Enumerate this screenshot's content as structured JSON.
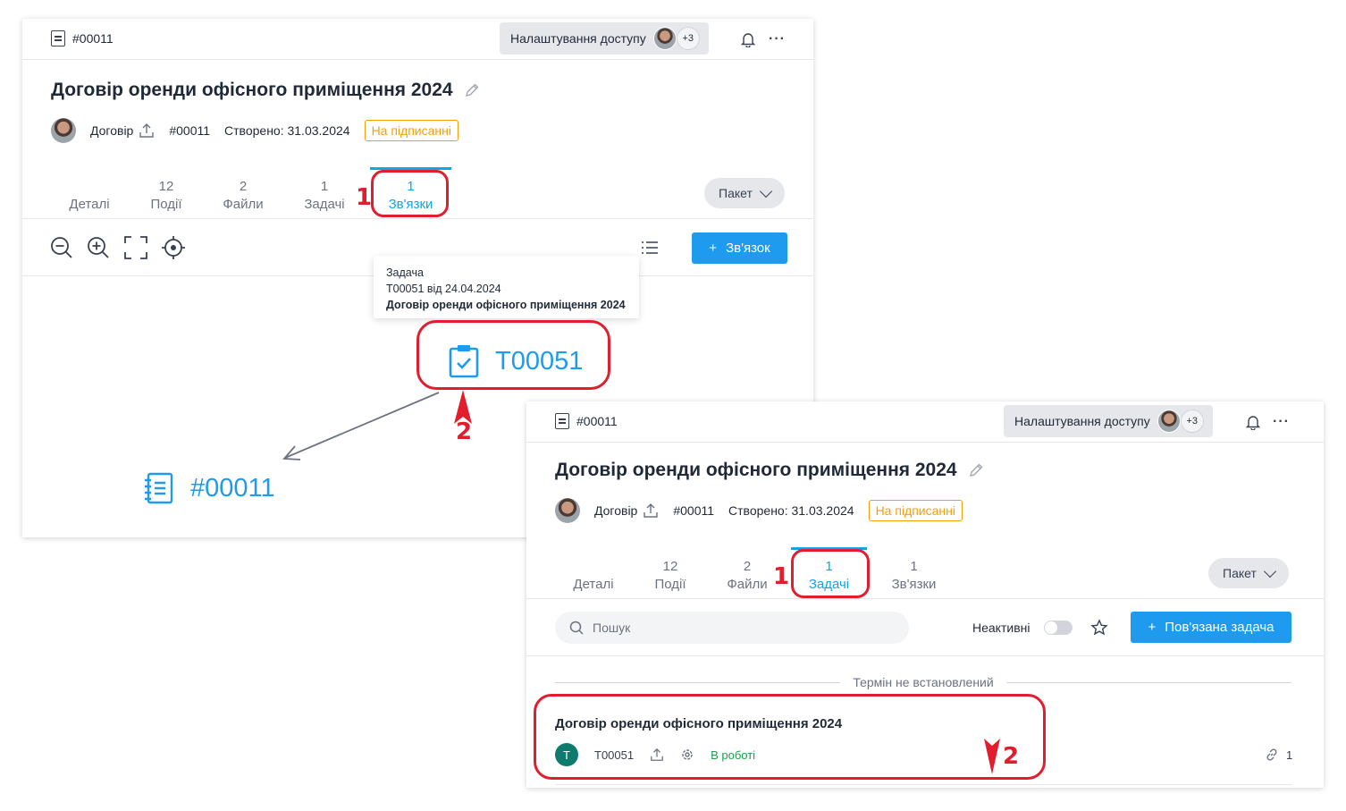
{
  "doc_id": "#00011",
  "access_settings_label": "Налаштування доступу",
  "access_extra": "+3",
  "document_title": "Договір оренди офісного приміщення 2024",
  "meta": {
    "type": "Договір",
    "number": "#00011",
    "created": "Створено: 31.03.2024",
    "status": "На підписанні"
  },
  "panel_a": {
    "tabs": [
      {
        "count": "",
        "label": "Деталі"
      },
      {
        "count": "12",
        "label": "Події"
      },
      {
        "count": "2",
        "label": "Файли"
      },
      {
        "count": "1",
        "label": "Задачі"
      },
      {
        "count": "1",
        "label": "Зв'язки"
      }
    ],
    "active_tab": "Зв'язки",
    "package_label": "Пакет",
    "add_link_label": "Зв'язок",
    "tooltip": {
      "line1": "Задача",
      "line2": "T00051 від 24.04.2024",
      "line3": "Договір оренди офісного приміщення 2024"
    },
    "task_node_label": "T00051",
    "doc_node_label": "#00011"
  },
  "panel_b": {
    "tabs": [
      {
        "count": "",
        "label": "Деталі"
      },
      {
        "count": "12",
        "label": "Події"
      },
      {
        "count": "2",
        "label": "Файли"
      },
      {
        "count": "1",
        "label": "Задачі"
      },
      {
        "count": "1",
        "label": "Зв'язки"
      }
    ],
    "active_tab": "Задачі",
    "package_label": "Пакет",
    "search_placeholder": "Пошук",
    "inactive_label": "Неактивні",
    "add_task_label": "Пов'язана задача",
    "group_label": "Термін не встановлений",
    "task": {
      "title": "Договір оренди офісного приміщення 2024",
      "avatar_letter": "T",
      "id": "T00051",
      "status": "В роботі",
      "links_count": "1"
    }
  },
  "annotations": {
    "n1": "1",
    "n2": "2"
  },
  "colors": {
    "accent": "#1e9bef",
    "status_badge": "#f59e0b",
    "annotation": "#e11d2e",
    "in_progress": "#16a34a"
  }
}
